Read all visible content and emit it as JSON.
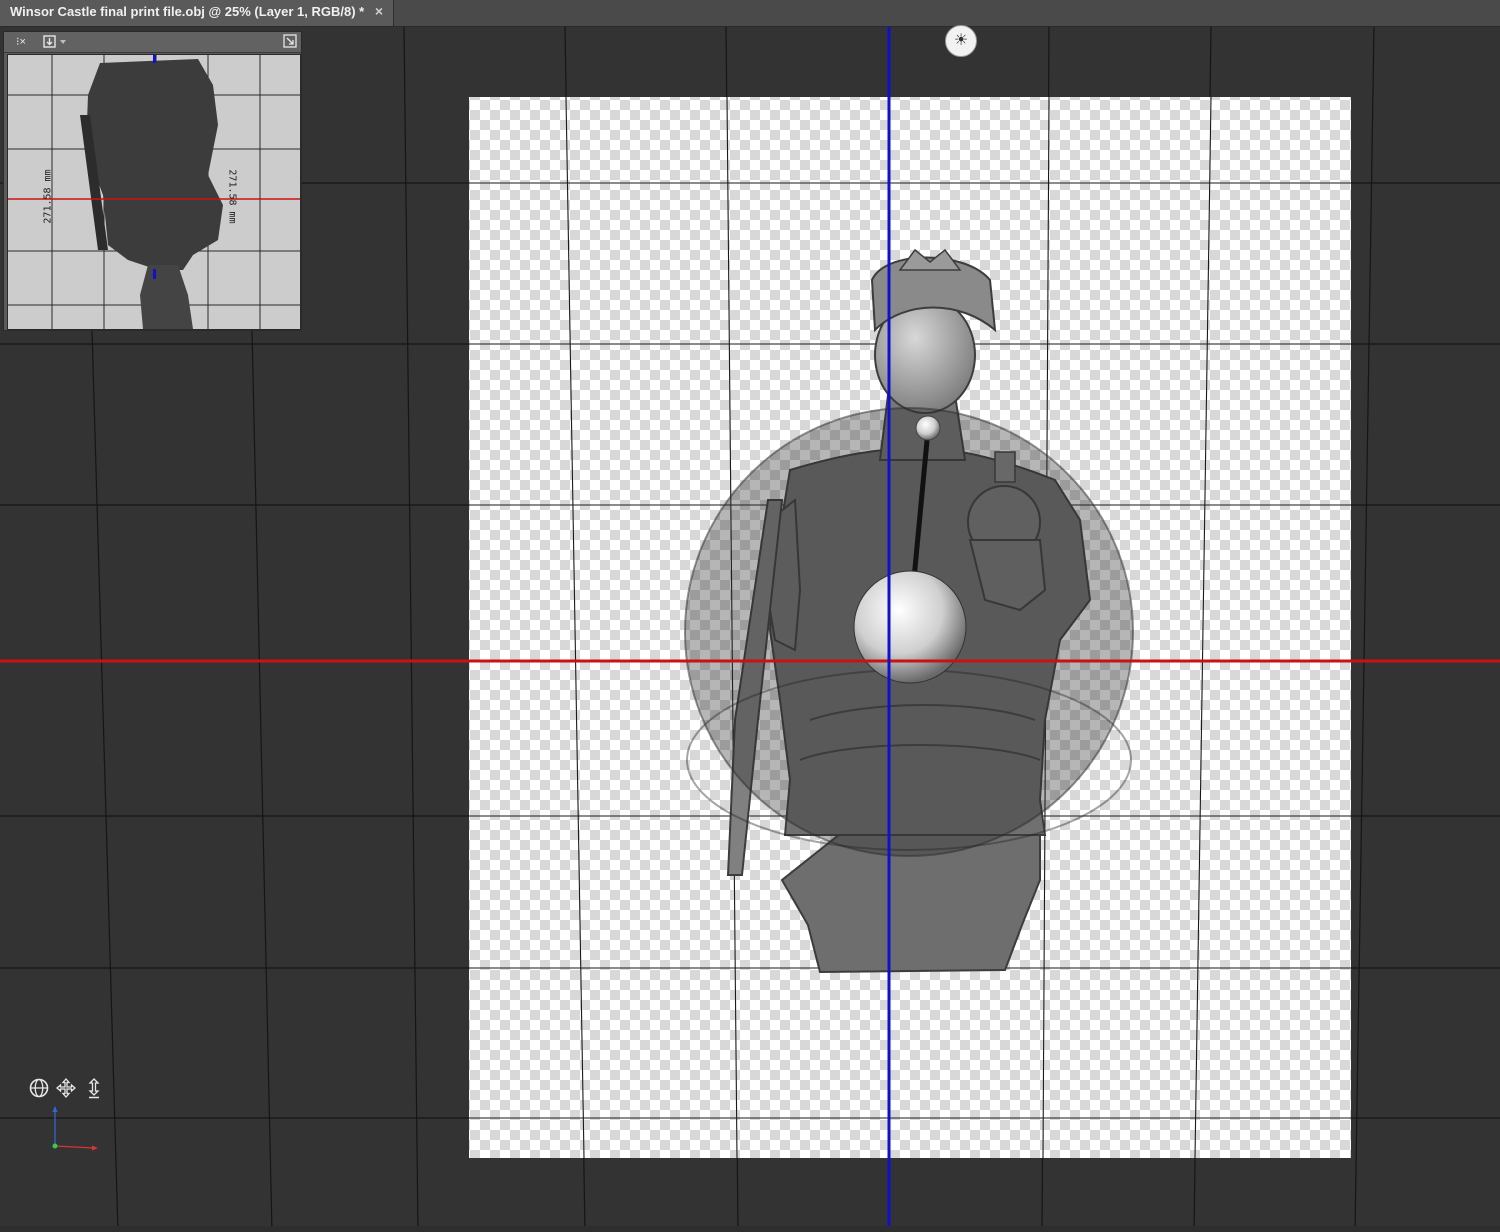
{
  "document": {
    "tab_title": "Winsor Castle final print file.obj @ 25% (Layer 1, RGB/8) *",
    "close_glyph": "×"
  },
  "navigator": {
    "menu_glyph": "⁝×",
    "dimension_label_left": "271.58 mm",
    "dimension_label_right": "271.58 mm"
  },
  "widgets": {
    "light_glyph": "☀",
    "tools": [
      "orbit-icon",
      "pan-icon",
      "dolly-icon"
    ]
  },
  "colors": {
    "canvas_bg": "#333333",
    "grid_line": "#151515",
    "x_axis": "#cc1111",
    "y_axis": "#1111cc",
    "checker_light": "#ffffff",
    "checker_dark": "#d8d8d8",
    "model": "#7a7a7a",
    "gizmo_green": "#33cc55",
    "gizmo_red": "#dd3333",
    "gizmo_blue": "#3366dd"
  }
}
